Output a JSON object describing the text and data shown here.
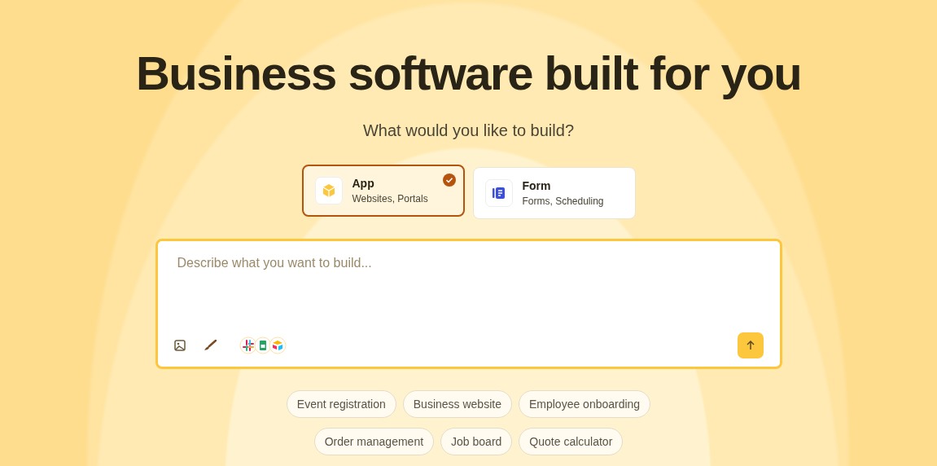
{
  "title": "Business software built for you",
  "subtitle": "What would you like to build?",
  "options": [
    {
      "kind": "app",
      "title": "App",
      "subtitle": "Websites, Portals",
      "selected": true
    },
    {
      "kind": "form",
      "title": "Form",
      "subtitle": "Forms, Scheduling",
      "selected": false
    }
  ],
  "prompt": {
    "placeholder": "Describe what you want to build..."
  },
  "suggestions": [
    [
      "Event registration",
      "Business website",
      "Employee onboarding"
    ],
    [
      "Order management",
      "Job board",
      "Quote calculator"
    ]
  ]
}
